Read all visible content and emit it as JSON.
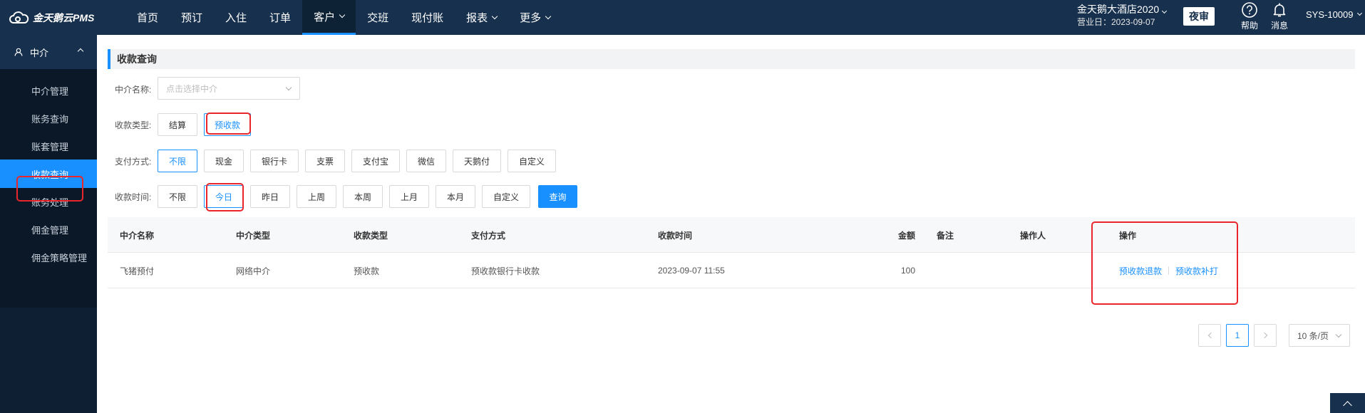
{
  "app": {
    "logo_text": "金天鹅云PMS"
  },
  "nav": [
    {
      "label": "首页",
      "has_dropdown": false,
      "active": false
    },
    {
      "label": "预订",
      "has_dropdown": false,
      "active": false
    },
    {
      "label": "入住",
      "has_dropdown": false,
      "active": false
    },
    {
      "label": "订单",
      "has_dropdown": false,
      "active": false
    },
    {
      "label": "客户",
      "has_dropdown": true,
      "active": true
    },
    {
      "label": "交班",
      "has_dropdown": false,
      "active": false
    },
    {
      "label": "现付账",
      "has_dropdown": false,
      "active": false
    },
    {
      "label": "报表",
      "has_dropdown": true,
      "active": false
    },
    {
      "label": "更多",
      "has_dropdown": true,
      "active": false
    }
  ],
  "header_right": {
    "hotel_name": "金天鹅大酒店2020",
    "business_date": "营业日：2023-09-07",
    "night_audit": "夜审",
    "help": "帮助",
    "messages": "消息",
    "user": "SYS-10009"
  },
  "sidebar": {
    "group": "中介",
    "items": [
      {
        "label": "中介管理",
        "active": false
      },
      {
        "label": "账务查询",
        "active": false
      },
      {
        "label": "账套管理",
        "active": false
      },
      {
        "label": "收款查询",
        "active": true
      },
      {
        "label": "账务处理",
        "active": false
      },
      {
        "label": "佣金管理",
        "active": false
      },
      {
        "label": "佣金策略管理",
        "active": false
      }
    ]
  },
  "page": {
    "title": "收款查询"
  },
  "filters": {
    "agent": {
      "label": "中介名称:",
      "placeholder": "点击选择中介"
    },
    "receipt_type": {
      "label": "收款类型:",
      "options": [
        "结算",
        "预收款"
      ],
      "selected": "预收款"
    },
    "pay_method": {
      "label": "支付方式:",
      "options": [
        "不限",
        "现金",
        "银行卡",
        "支票",
        "支付宝",
        "微信",
        "天鹅付",
        "自定义"
      ],
      "selected": "不限"
    },
    "time": {
      "label": "收款时间:",
      "options": [
        "不限",
        "今日",
        "昨日",
        "上周",
        "本周",
        "上月",
        "本月",
        "自定义"
      ],
      "selected": "今日"
    },
    "query_button": "查询"
  },
  "table": {
    "headers": {
      "agent_name": "中介名称",
      "agent_type": "中介类型",
      "receipt_type": "收款类型",
      "pay_method": "支付方式",
      "receipt_time": "收款时间",
      "amount": "金额",
      "note": "备注",
      "operator": "操作人",
      "actions": "操作"
    },
    "rows": [
      {
        "agent_name": "飞猪预付",
        "agent_type": "网络中介",
        "receipt_type": "预收款",
        "pay_method": "预收款银行卡收款",
        "receipt_time": "2023-09-07 11:55",
        "amount": "100",
        "note": "",
        "operator": "",
        "actions": [
          "预收款退款",
          "预收款补打"
        ]
      }
    ]
  },
  "pagination": {
    "current": "1",
    "page_size": "10 条/页"
  },
  "colors": {
    "primary": "#1890ff",
    "topbar": "#17304d",
    "sidebar": "#0a1827",
    "highlight": "#e8262b"
  }
}
